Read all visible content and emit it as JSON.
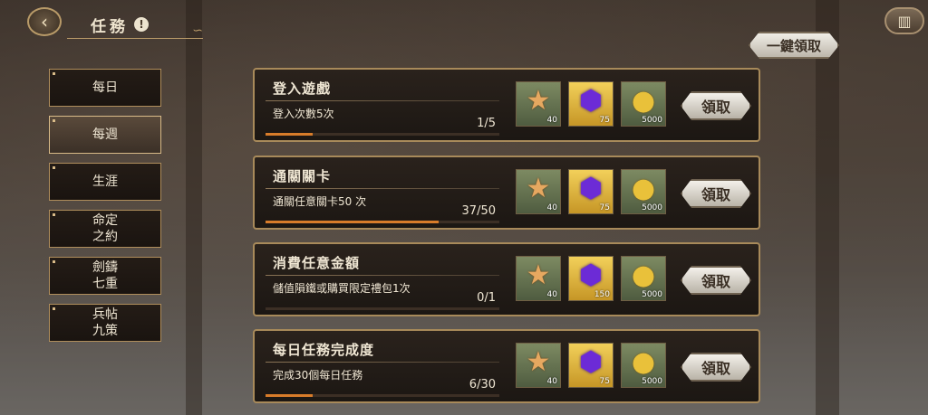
{
  "header": {
    "title": "任務",
    "info_icon": "!",
    "back_icon": "back-arrow-icon",
    "map_icon": "map-icon"
  },
  "claim_all_label": "一鍵領取",
  "tabs": [
    {
      "label": "每日",
      "active": false
    },
    {
      "label": "每週",
      "active": true
    },
    {
      "label": "生涯",
      "active": false
    },
    {
      "label": "命定\n之約",
      "active": false
    },
    {
      "label": "劍鑄\n七重",
      "active": false
    },
    {
      "label": "兵帖\n九策",
      "active": false
    }
  ],
  "tasks": [
    {
      "title": "登入遊戲",
      "desc": "登入次數5次",
      "progress_text": "1/5",
      "progress": 0.2,
      "rewards": [
        {
          "icon": "star-icon",
          "qty": "40"
        },
        {
          "icon": "gem-icon",
          "qty": "75"
        },
        {
          "icon": "coin-icon",
          "qty": "5000"
        }
      ],
      "claim_label": "領取"
    },
    {
      "title": "通關關卡",
      "desc": "通關任意關卡50 次",
      "progress_text": "37/50",
      "progress": 0.74,
      "rewards": [
        {
          "icon": "star-icon",
          "qty": "40"
        },
        {
          "icon": "gem-icon",
          "qty": "75"
        },
        {
          "icon": "coin-icon",
          "qty": "5000"
        }
      ],
      "claim_label": "領取"
    },
    {
      "title": "消費任意金額",
      "desc": "儲值隕鐵或購買限定禮包1次",
      "progress_text": "0/1",
      "progress": 0,
      "rewards": [
        {
          "icon": "star-icon",
          "qty": "40"
        },
        {
          "icon": "gem-icon",
          "qty": "150"
        },
        {
          "icon": "coin-icon",
          "qty": "5000"
        }
      ],
      "claim_label": "領取"
    },
    {
      "title": "每日任務完成度",
      "desc": "完成30個每日任務",
      "progress_text": "6/30",
      "progress": 0.2,
      "rewards": [
        {
          "icon": "star-icon",
          "qty": "40"
        },
        {
          "icon": "gem-icon",
          "qty": "75"
        },
        {
          "icon": "coin-icon",
          "qty": "5000"
        }
      ],
      "claim_label": "領取"
    }
  ]
}
